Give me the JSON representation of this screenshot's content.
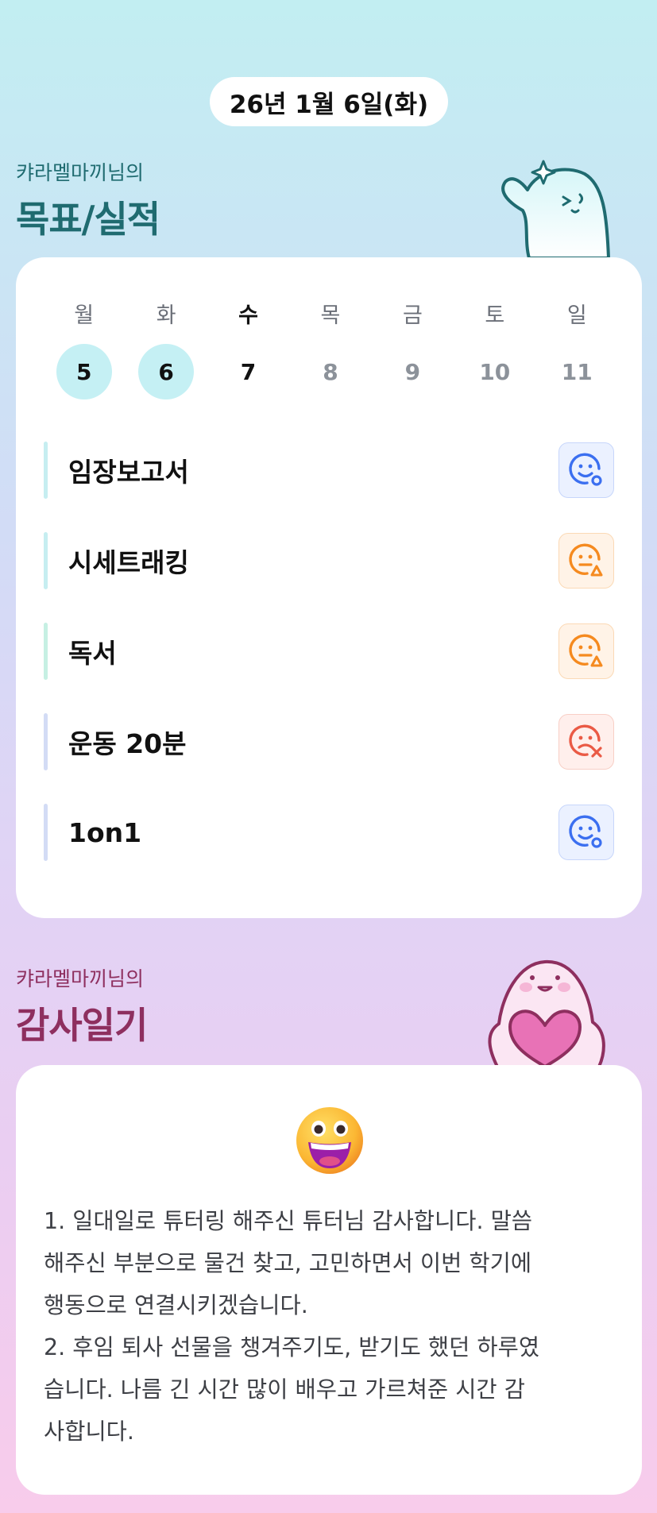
{
  "date_label": "26년 1월 6일(화)",
  "goals_section": {
    "subtitle": "캬라멜마끼님의",
    "title": "목표/실적",
    "colors": {
      "title": "#1f6b70"
    }
  },
  "week": {
    "days": [
      {
        "name": "월",
        "num": "5",
        "state": "done"
      },
      {
        "name": "화",
        "num": "6",
        "state": "done"
      },
      {
        "name": "수",
        "num": "7",
        "state": "today"
      },
      {
        "name": "목",
        "num": "8",
        "state": "future"
      },
      {
        "name": "금",
        "num": "9",
        "state": "future"
      },
      {
        "name": "토",
        "num": "10",
        "state": "future"
      },
      {
        "name": "일",
        "num": "11",
        "state": "future"
      }
    ]
  },
  "goals": [
    {
      "label": "임장보고서",
      "status": "good",
      "status_icon": "smile-o-icon",
      "bar_color": "#c6eef1"
    },
    {
      "label": "시세트래킹",
      "status": "mid",
      "status_icon": "neutral-triangle-icon",
      "bar_color": "#c6eef1"
    },
    {
      "label": "독서",
      "status": "mid",
      "status_icon": "neutral-triangle-icon",
      "bar_color": "#c6f0e3"
    },
    {
      "label": "운동 20분",
      "status": "bad",
      "status_icon": "sad-x-icon",
      "bar_color": "#d3dcf5"
    },
    {
      "label": "1on1",
      "status": "good",
      "status_icon": "smile-o-icon",
      "bar_color": "#d3dcf5"
    }
  ],
  "status_colors": {
    "good": "#3b6ff0",
    "mid": "#f58a1f",
    "bad": "#ea5a45"
  },
  "gratitude_section": {
    "subtitle": "캬라멜마끼님의",
    "title": "감사일기",
    "colors": {
      "title": "#8e2f5f"
    }
  },
  "gratitude": {
    "emoji": "grinning-face-emoji",
    "text": "1. 일대일로 튜터링 해주신 튜터님 감사합니다. 말씀\n해주신 부분으로 물건 찾고, 고민하면서 이번 학기에\n행동으로 연결시키겠습니다.\n2. 후임 퇴사 선물을 챙겨주기도, 받기도 했던 하루였\n습니다. 나름 긴 시간 많이 배우고 가르쳐준 시간 감\n사합니다."
  }
}
